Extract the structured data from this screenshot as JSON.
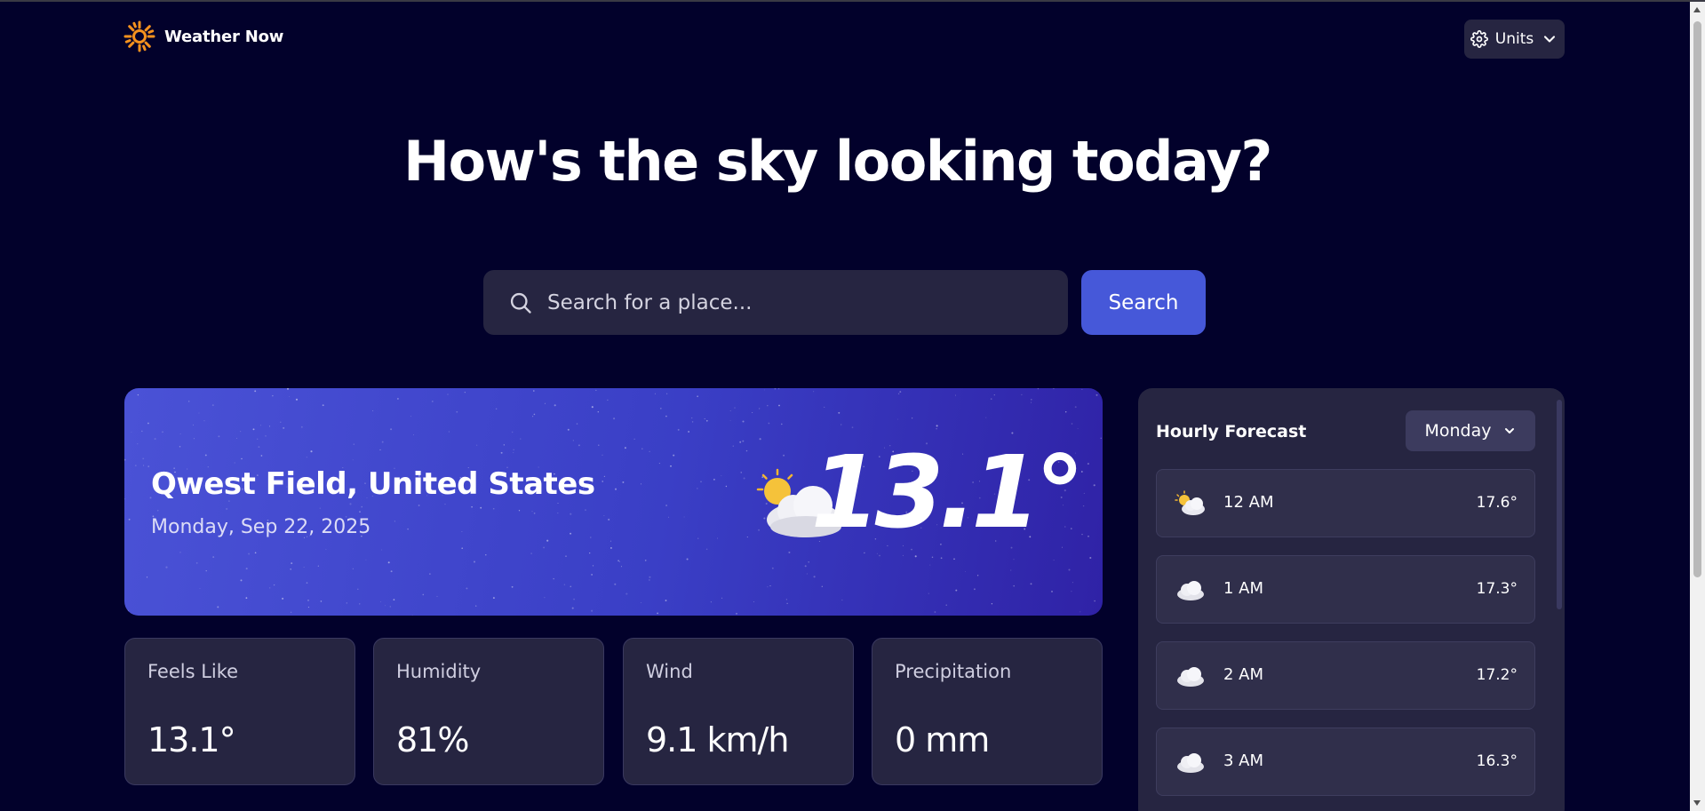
{
  "header": {
    "app_name": "Weather Now",
    "logo_icon": "sun-icon",
    "units_label": "Units",
    "units_icon": "gear-icon"
  },
  "hero": {
    "headline": "How's the sky looking today?"
  },
  "search": {
    "placeholder": "Search for a place...",
    "value": "",
    "button_label": "Search",
    "icon": "search-icon"
  },
  "current": {
    "location": "Qwest Field, United States",
    "date": "Monday, Sep 22, 2025",
    "temperature": "13.1°",
    "condition_icon": "partly-cloudy-icon"
  },
  "stats": [
    {
      "label": "Feels Like",
      "value": "13.1°"
    },
    {
      "label": "Humidity",
      "value": "81%"
    },
    {
      "label": "Wind",
      "value": "9.1 km/h"
    },
    {
      "label": "Precipitation",
      "value": "0 mm"
    }
  ],
  "hourly": {
    "title": "Hourly Forecast",
    "selected_day": "Monday",
    "items": [
      {
        "time": "12 AM",
        "temp": "17.6°",
        "icon": "partly-cloudy-icon"
      },
      {
        "time": "1 AM",
        "temp": "17.3°",
        "icon": "cloud-icon"
      },
      {
        "time": "2 AM",
        "temp": "17.2°",
        "icon": "cloud-icon"
      },
      {
        "time": "3 AM",
        "temp": "16.3°",
        "icon": "cloud-icon"
      }
    ]
  },
  "colors": {
    "background": "#02012b",
    "card": "#262541",
    "accent": "#4658d9",
    "logo": "#f5921e"
  }
}
